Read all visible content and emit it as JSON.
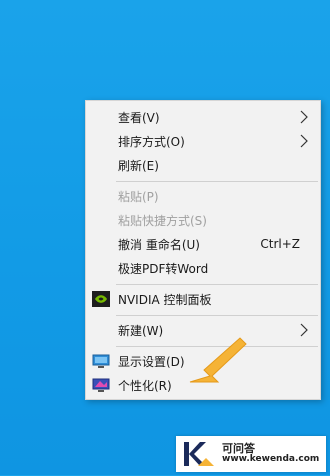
{
  "context_menu": {
    "items": [
      {
        "label": "查看(V)",
        "has_submenu": true
      },
      {
        "label": "排序方式(O)",
        "has_submenu": true
      },
      {
        "label": "刷新(E)"
      },
      {
        "label": "粘贴(P)",
        "disabled": true
      },
      {
        "label": "粘贴快捷方式(S)",
        "disabled": true
      },
      {
        "label": "撤消 重命名(U)",
        "shortcut": "Ctrl+Z"
      },
      {
        "label": "极速PDF转Word"
      },
      {
        "label": "NVIDIA 控制面板",
        "icon": "nvidia-icon"
      },
      {
        "label": "新建(W)",
        "has_submenu": true
      },
      {
        "label": "显示设置(D)",
        "icon": "display-settings-icon"
      },
      {
        "label": "个性化(R)",
        "icon": "personalize-icon"
      }
    ]
  },
  "watermark": {
    "title": "可问答",
    "url": "www.kewenda.com",
    "logo_letter": "K"
  },
  "colors": {
    "desktop": "#129be6",
    "menu_bg": "#f2f2f2",
    "highlight_arrow": "#f5b336",
    "nvidia_green": "#76b900"
  }
}
